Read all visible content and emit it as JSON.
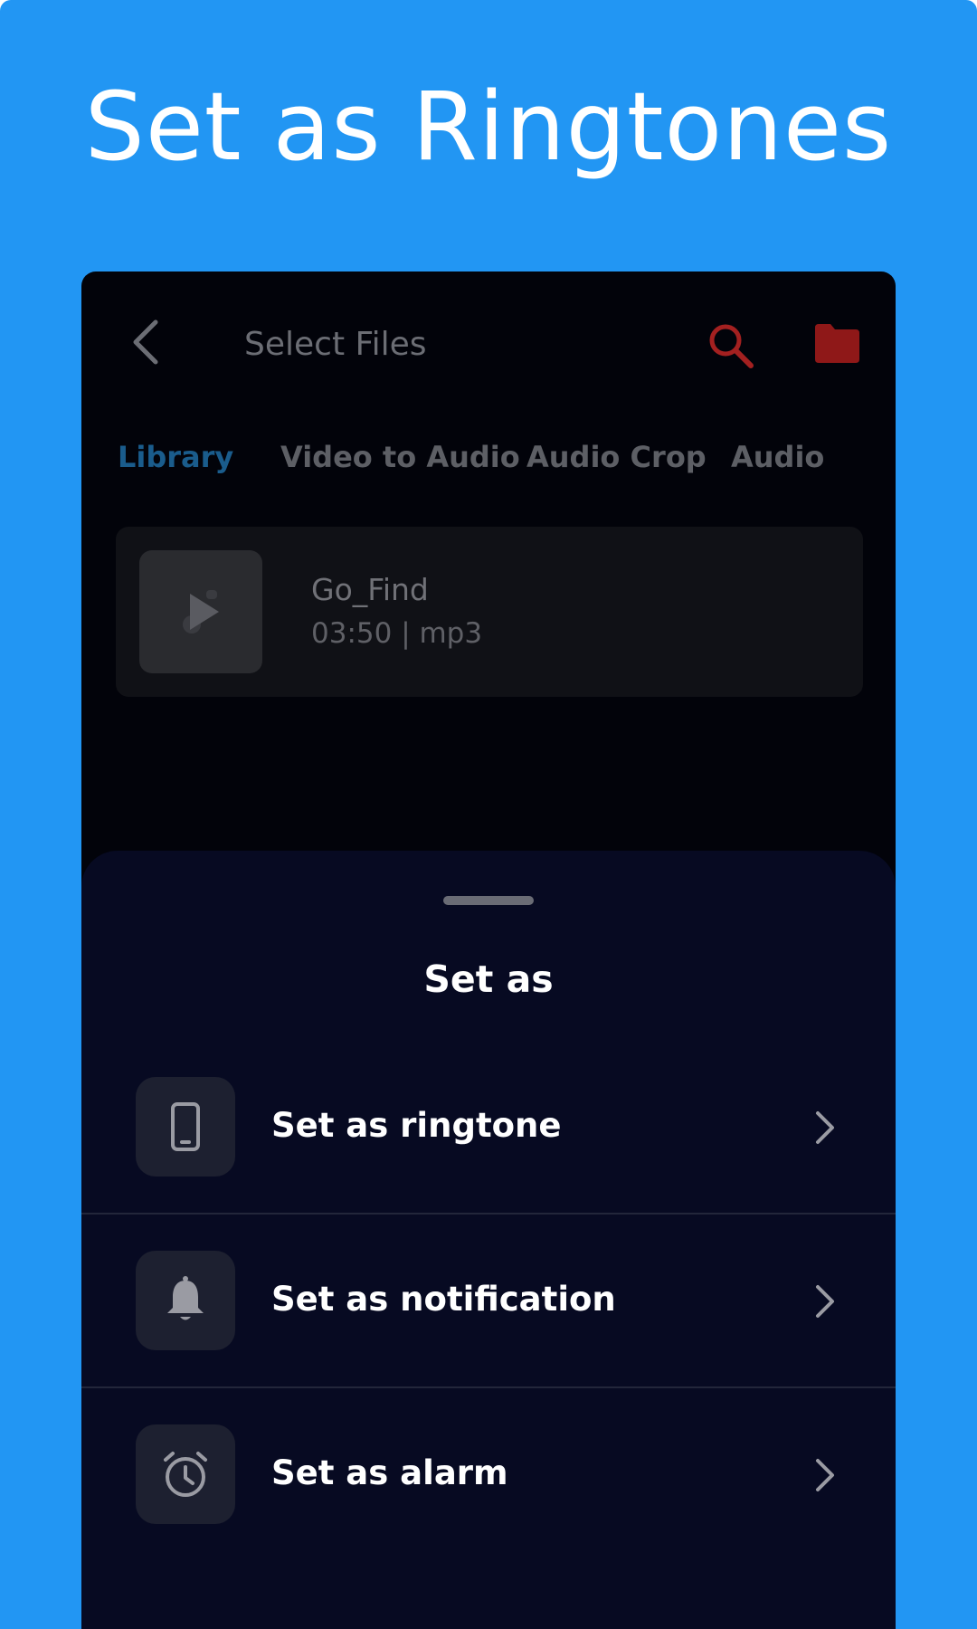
{
  "promo": {
    "headline": "Set as Ringtones",
    "background_color": "#2296f3"
  },
  "appbar": {
    "title": "Select Files",
    "back_icon": "chevron-left-icon",
    "search_icon": "search-icon",
    "folder_icon": "folder-icon",
    "accent_color": "#b22222"
  },
  "tabs": [
    {
      "label": "Library",
      "active": true
    },
    {
      "label": "Video to Audio",
      "active": false
    },
    {
      "label": "Audio Crop",
      "active": false
    },
    {
      "label": "Audio",
      "active": false
    }
  ],
  "file": {
    "name": "Go_Find",
    "meta": "03:50 | mp3",
    "thumb_icon": "music-play-icon"
  },
  "sheet": {
    "title": "Set as",
    "options": [
      {
        "label": "Set as ringtone",
        "icon": "phone-icon"
      },
      {
        "label": "Set as notification",
        "icon": "bell-icon"
      },
      {
        "label": "Set as alarm",
        "icon": "alarm-clock-icon"
      }
    ]
  }
}
